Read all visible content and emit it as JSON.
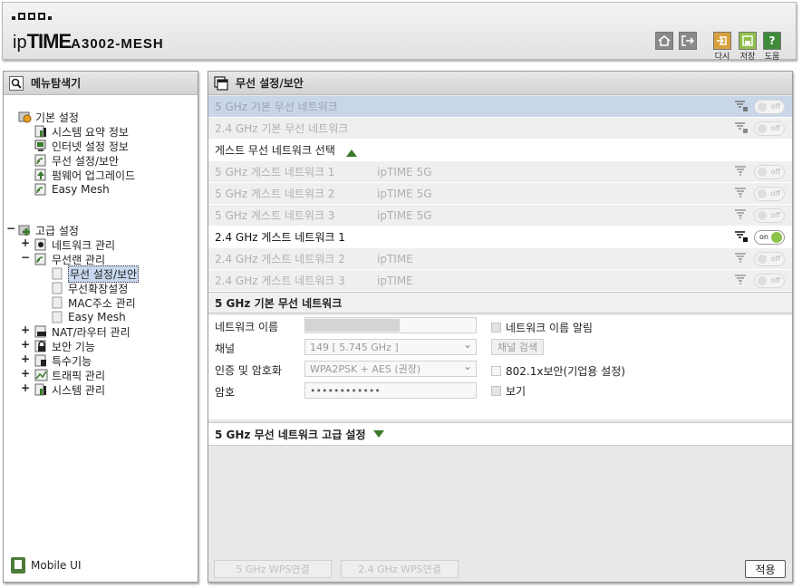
{
  "header": {
    "logo_ip": "ip",
    "logo_time": "TIME",
    "model": "A3002-MESH",
    "buttons": [
      {
        "icon": "home-icon",
        "label": ""
      },
      {
        "icon": "logout-icon",
        "label": ""
      },
      {
        "icon": "restart-icon",
        "label": "다시"
      },
      {
        "icon": "save-icon",
        "label": "저장"
      },
      {
        "icon": "help-icon",
        "label": "도움"
      }
    ]
  },
  "menu": {
    "title": "메뉴탐색기",
    "basic": {
      "label": "기본 설정",
      "items": [
        "시스템 요약 정보",
        "인터넷 설정 정보",
        "무선 설정/보안",
        "펌웨어 업그레이드",
        "Easy Mesh"
      ]
    },
    "advanced": {
      "label": "고급 설정",
      "network": "네트워크 관리",
      "wlan": "무선랜 관리",
      "wlan_items": [
        "무선 설정/보안",
        "무선확장설정",
        "MAC주소 관리",
        "Easy Mesh"
      ],
      "nat": "NAT/라우터 관리",
      "security": "보안 기능",
      "special": "특수기능",
      "traffic": "트래픽 관리",
      "system": "시스템 관리"
    },
    "mobile": "Mobile UI"
  },
  "main": {
    "title": "무선 설정/보안",
    "networks": [
      {
        "name": "5 GHz 기본 무선 네트워크",
        "ssid": "",
        "state": "off"
      },
      {
        "name": "2.4 GHz 기본 무선 네트워크",
        "ssid": "",
        "state": "off"
      },
      {
        "name": "5 GHz 게스트 네트워크 1",
        "ssid": "ipTIME 5G",
        "state": "off"
      },
      {
        "name": "5 GHz 게스트 네트워크 2",
        "ssid": "ipTIME 5G",
        "state": "off"
      },
      {
        "name": "5 GHz 게스트 네트워크 3",
        "ssid": "ipTIME 5G",
        "state": "off"
      },
      {
        "name": "2.4 GHz 게스트 네트워크 1",
        "ssid": "",
        "state": "on"
      },
      {
        "name": "2.4 GHz 게스트 네트워크 2",
        "ssid": "ipTIME",
        "state": "off"
      },
      {
        "name": "2.4 GHz 게스트 네트워크 3",
        "ssid": "ipTIME",
        "state": "off"
      }
    ],
    "guest_select_label": "게스트 무선 네트워크 선택",
    "section_title": "5 GHz 기본 무선 네트워크",
    "form": {
      "ssid_label": "네트워크 이름",
      "ssid_value": "",
      "broadcast_label": "네트워크 이름 알림",
      "channel_label": "채널",
      "channel_value": "149 [ 5.745 GHz ]",
      "channel_scan": "채널 검색",
      "auth_label": "인증 및 암호화",
      "auth_value": "WPA2PSK + AES (권장)",
      "enterprise_label": "802.1x보안(기업용 설정)",
      "password_label": "암호",
      "password_value": "••••••••••••",
      "show_label": "보기"
    },
    "advanced_title": "5 GHz 무선 네트워크 고급 설정",
    "wps_5g": "5 GHz WPS연결",
    "wps_24g": "2.4 GHz WPS연결",
    "apply": "적용"
  }
}
